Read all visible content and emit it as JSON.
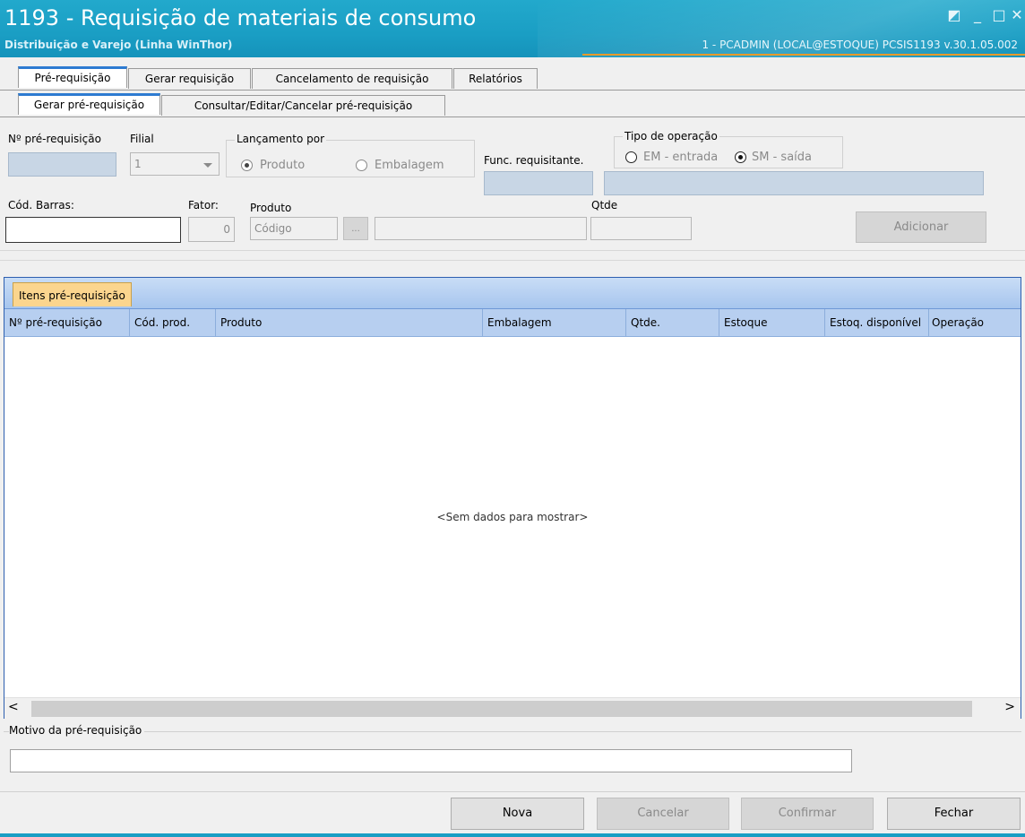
{
  "window": {
    "title": "1193 - Requisição de materiais de consumo",
    "subtitle": "Distribuição e Varejo (Linha WinThor)",
    "user_info": "1 - PCADMIN (LOCAL@ESTOQUE)   PCSIS1193  v.30.1.05.002",
    "controls": {
      "restore": "◩",
      "minimize": "_",
      "maximize": "□",
      "close": "✕"
    }
  },
  "tabs_top": [
    "Pré-requisição",
    "Gerar requisição",
    "Cancelamento de requisição",
    "Relatórios"
  ],
  "tabs_sub": [
    "Gerar pré-requisição",
    "Consultar/Editar/Cancelar  pré-requisição"
  ],
  "form": {
    "num_prereq_label": "Nº pré-requisição",
    "filial_label": "Filial",
    "filial_value": "1",
    "lancamento_label": "Lançamento por",
    "lancamento_options": [
      "Produto",
      "Embalagem"
    ],
    "func_req_label": "Func. requisitante.",
    "tipo_operacao_label": "Tipo de operação",
    "tipo_operacao_options": [
      "EM - entrada",
      "SM - saída"
    ],
    "cod_barras_label": "Cód. Barras:",
    "fator_label": "Fator:",
    "fator_value": "0",
    "produto_label": "Produto",
    "produto_code_value": "Código",
    "ellipsis": "...",
    "qtde_label": "Qtde",
    "adicionar_label": "Adicionar"
  },
  "grid": {
    "tab_label": "Itens pré-requisição",
    "columns": [
      "Nº pré-requisição",
      "Cód. prod.",
      "Produto",
      "Embalagem",
      "Qtde.",
      "Estoque",
      "Estoq. disponível",
      "Operação"
    ],
    "empty_message": "<Sem dados para mostrar>",
    "scroll_left": "<",
    "scroll_right": ">"
  },
  "motivo_label": "Motivo da pré-requisição",
  "buttons": {
    "nova": "Nova",
    "cancelar": "Cancelar",
    "confirmar": "Confirmar",
    "fechar": "Fechar"
  },
  "colors": {
    "titlebar": "#1a9ec4",
    "grid_tab": "#fbd58e",
    "accent_tab": "#2d7bd1",
    "disabled_field": "#c8d6e5"
  }
}
